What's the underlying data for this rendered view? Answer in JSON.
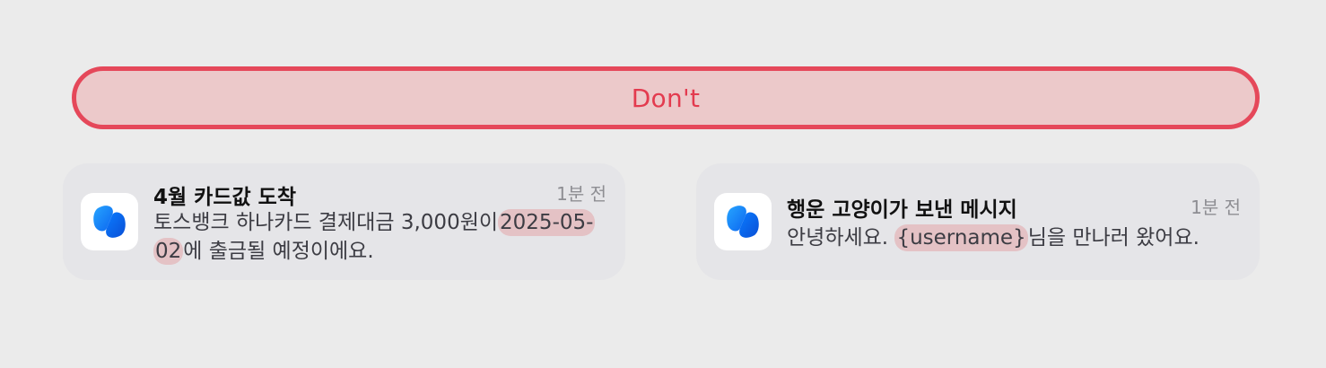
{
  "banner": {
    "label": "Don't",
    "border_color": "#e5485a",
    "fill_color": "#ecc9ca"
  },
  "notifications": [
    {
      "app_icon": "toss-app-icon",
      "title": "4월 카드값 도착",
      "time": "1분 전",
      "body_prefix": "토스뱅크 하나카드 결제대금 3,000원이",
      "body_highlight": "2025-05-02",
      "body_suffix": "에 출금될 예정이에요."
    },
    {
      "app_icon": "toss-app-icon",
      "title": "행운 고양이가 보낸 메시지",
      "time": "1분 전",
      "body_prefix": "안녕하세요. ",
      "body_highlight": "{username}",
      "body_suffix": "님을 만나러 왔어요."
    }
  ],
  "highlight_color": "#e2787d"
}
